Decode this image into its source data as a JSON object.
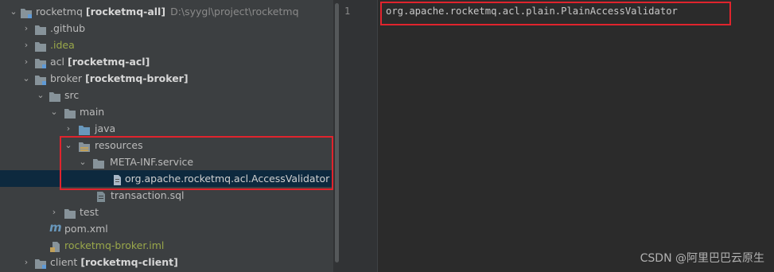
{
  "tree": {
    "root": {
      "name": "rocketmq",
      "module": "[rocketmq-all]",
      "path": "D:\\syygl\\project\\rocketmq"
    },
    "github": {
      "label": ".github"
    },
    "idea": {
      "label": ".idea"
    },
    "acl": {
      "name": "acl",
      "module": "[rocketmq-acl]"
    },
    "broker": {
      "name": "broker",
      "module": "[rocketmq-broker]"
    },
    "src": {
      "label": "src"
    },
    "main": {
      "label": "main"
    },
    "java": {
      "label": "java"
    },
    "resources": {
      "label": "resources"
    },
    "metainf": {
      "label": "META-INF.service"
    },
    "validator_file": {
      "label": "org.apache.rocketmq.acl.AccessValidator"
    },
    "transaction": {
      "label": "transaction.sql"
    },
    "test": {
      "label": "test"
    },
    "pom": {
      "label": "pom.xml"
    },
    "iml": {
      "label": "rocketmq-broker.iml"
    },
    "client": {
      "name": "client",
      "module": "[rocketmq-client]"
    }
  },
  "editor": {
    "line_number": "1",
    "line_text": "org.apache.rocketmq.acl.plain.PlainAccessValidator"
  },
  "colors": {
    "folder": "#87939a",
    "source_folder": "#6897bb",
    "resource_folder": "#c0a05a",
    "highlight": "#e0242d"
  },
  "watermark": "CSDN @阿里巴巴云原生"
}
